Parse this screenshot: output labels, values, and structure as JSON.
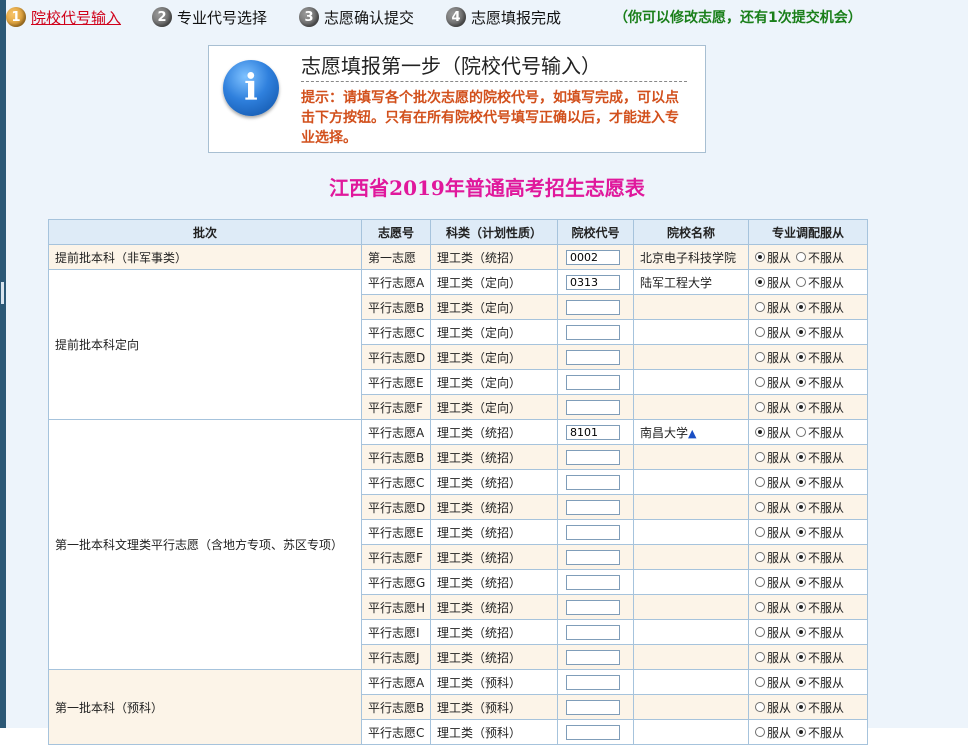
{
  "steps": [
    {
      "num": "1",
      "label": "院校代号输入",
      "active": true
    },
    {
      "num": "2",
      "label": "专业代号选择",
      "active": false
    },
    {
      "num": "3",
      "label": "志愿确认提交",
      "active": false
    },
    {
      "num": "4",
      "label": "志愿填报完成",
      "active": false
    }
  ],
  "notice": "（你可以修改志愿，还有1次提交机会）",
  "info": {
    "icon": "info-icon",
    "title": "志愿填报第一步（院校代号输入）",
    "tip": "提示：请填写各个批次志愿的院校代号，如填写完成，可以点击下方按钮。只有在所有院校代号填写正确以后，才能进入专业选择。"
  },
  "page_title": "江西省2019年普通高考招生志愿表",
  "table": {
    "headers": [
      "批次",
      "志愿号",
      "科类（计划性质）",
      "院校代号",
      "院校名称",
      "专业调配服从"
    ],
    "radio_labels": {
      "yes": "服从",
      "no": "不服从"
    },
    "rows": [
      {
        "batch": "提前批本科（非军事类）",
        "vol": "第一志愿",
        "cat": "理工类（统招）",
        "code": "0002",
        "school": "北京电子科技学院",
        "marker": ""
      },
      {
        "batch": "提前批本科定向",
        "vol": "平行志愿A",
        "cat": "理工类（定向）",
        "code": "0313",
        "school": "陆军工程大学",
        "marker": ""
      },
      {
        "batch": "",
        "vol": "平行志愿B",
        "cat": "理工类（定向）",
        "code": "",
        "school": "",
        "marker": ""
      },
      {
        "batch": "",
        "vol": "平行志愿C",
        "cat": "理工类（定向）",
        "code": "",
        "school": "",
        "marker": ""
      },
      {
        "batch": "",
        "vol": "平行志愿D",
        "cat": "理工类（定向）",
        "code": "",
        "school": "",
        "marker": ""
      },
      {
        "batch": "",
        "vol": "平行志愿E",
        "cat": "理工类（定向）",
        "code": "",
        "school": "",
        "marker": ""
      },
      {
        "batch": "",
        "vol": "平行志愿F",
        "cat": "理工类（定向）",
        "code": "",
        "school": "",
        "marker": ""
      },
      {
        "batch": "第一批本科文理类平行志愿（含地方专项、苏区专项）",
        "vol": "平行志愿A",
        "cat": "理工类（统招）",
        "code": "8101",
        "school": "南昌大学",
        "marker": "▲"
      },
      {
        "batch": "",
        "vol": "平行志愿B",
        "cat": "理工类（统招）",
        "code": "",
        "school": "",
        "marker": ""
      },
      {
        "batch": "",
        "vol": "平行志愿C",
        "cat": "理工类（统招）",
        "code": "",
        "school": "",
        "marker": ""
      },
      {
        "batch": "",
        "vol": "平行志愿D",
        "cat": "理工类（统招）",
        "code": "",
        "school": "",
        "marker": ""
      },
      {
        "batch": "",
        "vol": "平行志愿E",
        "cat": "理工类（统招）",
        "code": "",
        "school": "",
        "marker": ""
      },
      {
        "batch": "",
        "vol": "平行志愿F",
        "cat": "理工类（统招）",
        "code": "",
        "school": "",
        "marker": ""
      },
      {
        "batch": "",
        "vol": "平行志愿G",
        "cat": "理工类（统招）",
        "code": "",
        "school": "",
        "marker": ""
      },
      {
        "batch": "",
        "vol": "平行志愿H",
        "cat": "理工类（统招）",
        "code": "",
        "school": "",
        "marker": ""
      },
      {
        "batch": "",
        "vol": "平行志愿I",
        "cat": "理工类（统招）",
        "code": "",
        "school": "",
        "marker": ""
      },
      {
        "batch": "",
        "vol": "平行志愿J",
        "cat": "理工类（统招）",
        "code": "",
        "school": "",
        "marker": ""
      },
      {
        "batch": "第一批本科（预科）",
        "vol": "平行志愿A",
        "cat": "理工类（预科）",
        "code": "",
        "school": "",
        "marker": ""
      },
      {
        "batch": "",
        "vol": "平行志愿B",
        "cat": "理工类（预科）",
        "code": "",
        "school": "",
        "marker": ""
      },
      {
        "batch": "",
        "vol": "平行志愿C",
        "cat": "理工类（预科）",
        "code": "",
        "school": "",
        "marker": ""
      }
    ],
    "adjust": [
      "yes",
      "yes",
      "no",
      "no",
      "no",
      "no",
      "no",
      "yes",
      "no",
      "no",
      "no",
      "no",
      "no",
      "no",
      "no",
      "no",
      "no",
      "no",
      "no",
      "no"
    ]
  }
}
